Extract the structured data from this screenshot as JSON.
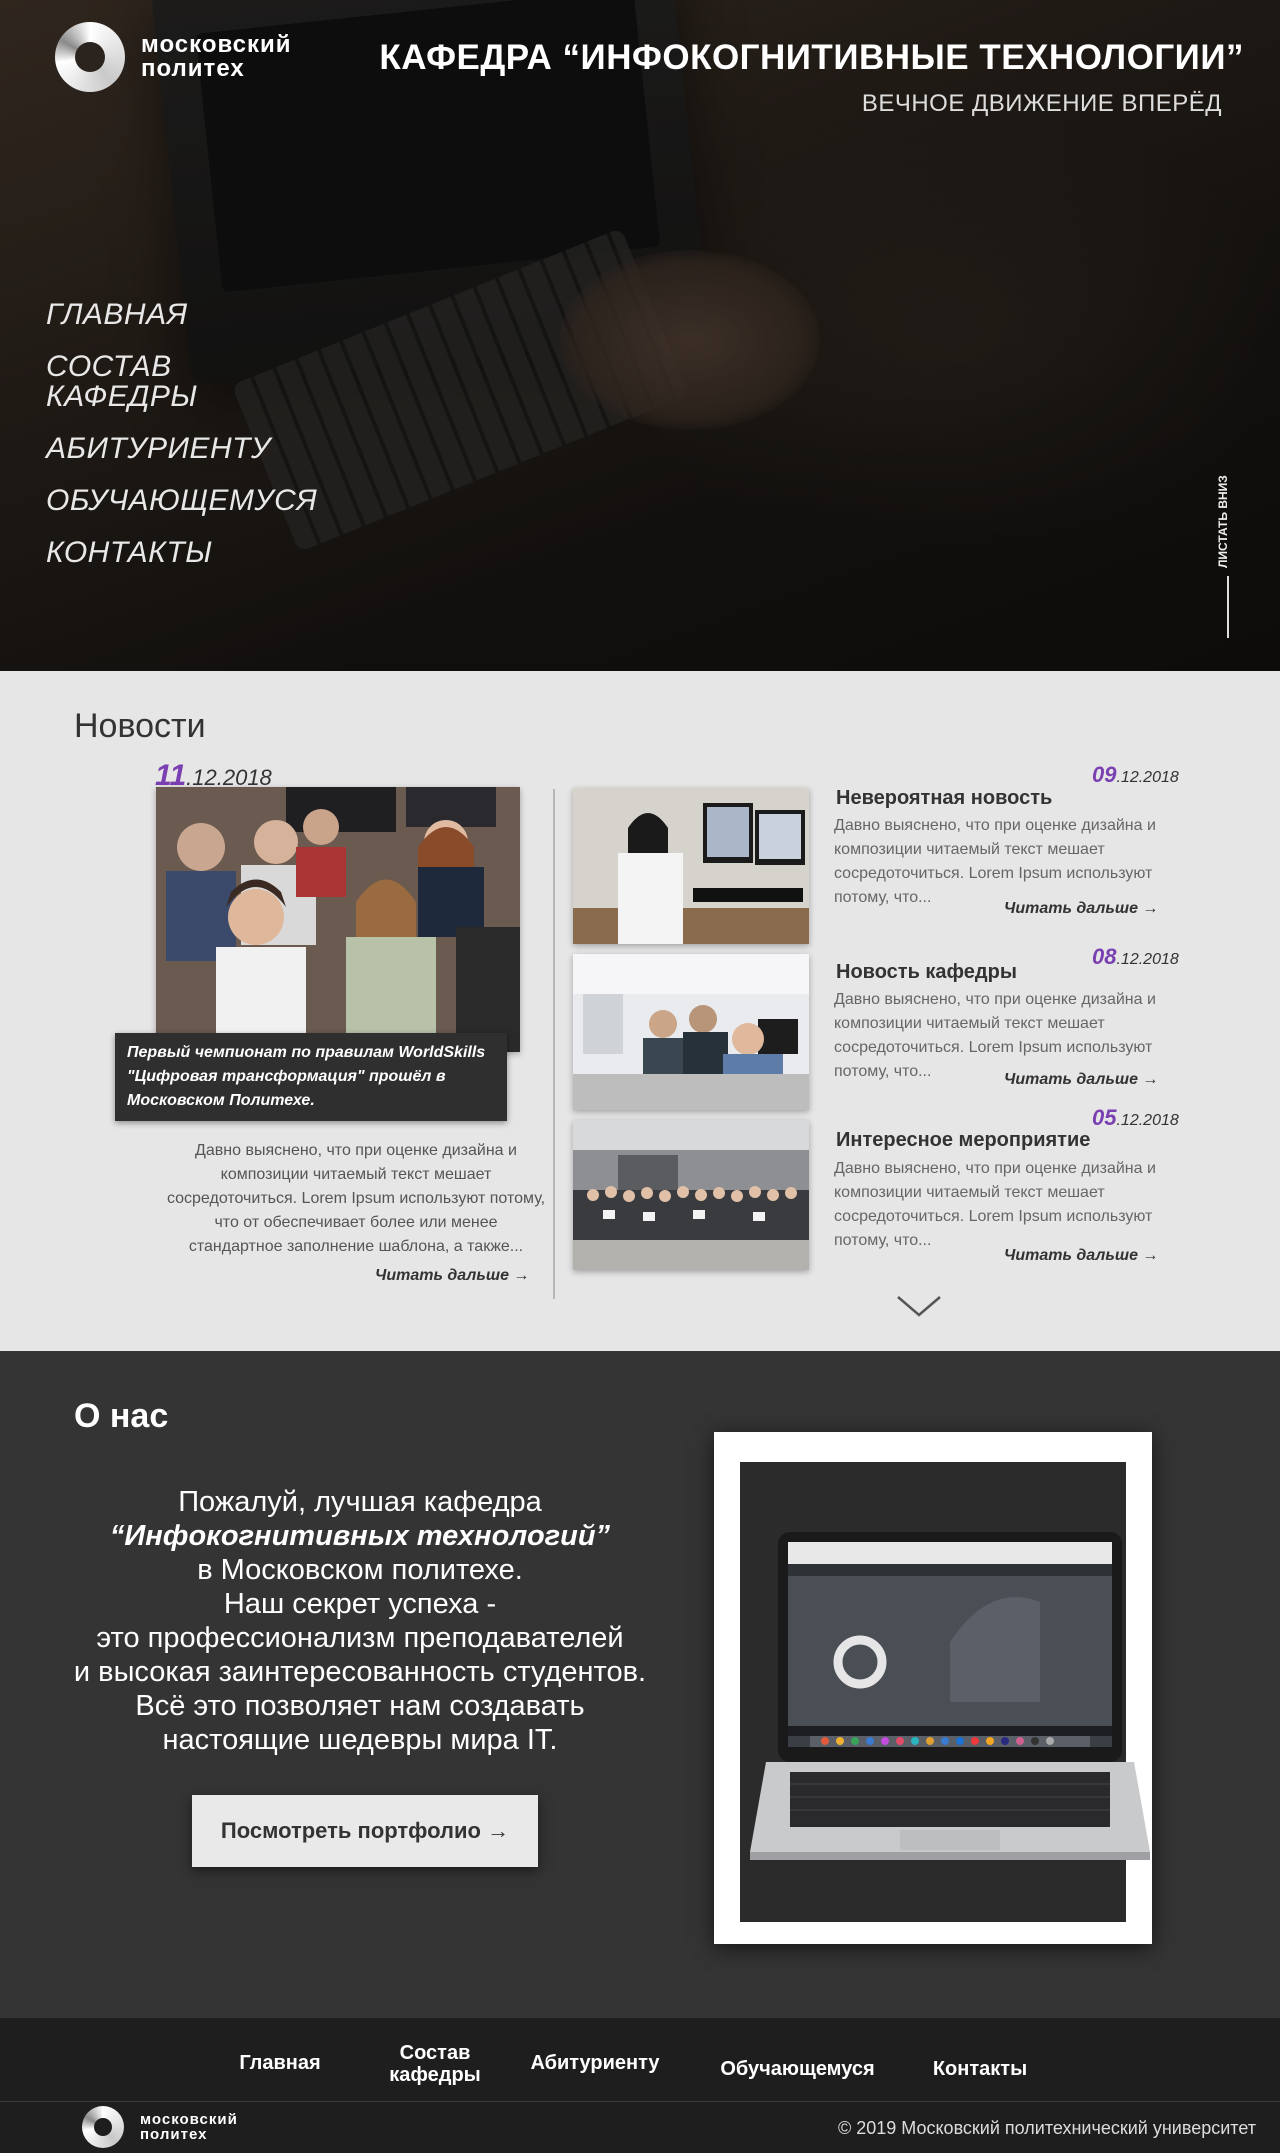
{
  "header": {
    "logo_text": "московский политех",
    "title": "КАФЕДРА “ИНФОКОГНИТИВНЫЕ ТЕХНОЛОГИИ”",
    "subtitle": "ВЕЧНОЕ ДВИЖЕНИЕ ВПЕРЁД"
  },
  "side_nav": {
    "items": [
      {
        "label": "ГЛАВНАЯ"
      },
      {
        "label": "СОСТАВ КАФЕДРЫ"
      },
      {
        "label": "АБИТУРИЕНТУ"
      },
      {
        "label": "ОБУЧАЮЩЕМУСЯ"
      },
      {
        "label": "КОНТАКТЫ"
      }
    ]
  },
  "scroll_hint": "ЛИСТАТЬ ВНИЗ",
  "news": {
    "heading": "Новости",
    "featured": {
      "date_day": "11",
      "date_rest": ".12.2018",
      "caption": "Первый чемпионат по правилам WorldSkills \"Цифровая трансформация\" прошёл в Московском Политехе.",
      "text": "Давно выяснено, что при оценке дизайна и композиции читаемый текст мешает сосредоточиться. Lorem Ipsum используют потому, что от обеспечивает более или менее стандартное заполнение шаблона, а также...",
      "more": "Читать дальше →"
    },
    "items": [
      {
        "title": "Невероятная новость",
        "date_day": "09",
        "date_rest": ".12.2018",
        "text": "Давно выяснено, что при оценке дизайна и композиции читаемый текст мешает сосредоточиться. Lorem Ipsum используют потому, что...",
        "more": "Читать дальше →"
      },
      {
        "title": "Новость кафедры",
        "date_day": "08",
        "date_rest": ".12.2018",
        "text": "Давно выяснено, что при оценке дизайна и композиции читаемый текст мешает сосредоточиться. Lorem Ipsum используют потому, что...",
        "more": "Читать дальше →"
      },
      {
        "title": "Интересное мероприятие",
        "date_day": "05",
        "date_rest": ".12.2018",
        "text": "Давно выяснено, что при оценке дизайна и композиции читаемый текст мешает сосредоточиться. Lorem Ipsum используют потому, что...",
        "more": "Читать дальше →"
      }
    ]
  },
  "about": {
    "heading": "О нас",
    "line1": "Пожалуй, лучшая кафедра",
    "line2": "“Инфокогнитивных технологий”",
    "line3": "в Московском политехе.",
    "line4": "Наш секрет успеха -",
    "line5": "это профессионализм преподавателей",
    "line6": "и высокая заинтересованность студентов.",
    "line7": "Всё это позволяет нам создавать",
    "line8": "настоящие шедевры мира IT.",
    "button": "Посмотреть портфолио →"
  },
  "footer": {
    "nav": [
      {
        "label": "Главная"
      },
      {
        "label": "Состав кафедры"
      },
      {
        "label": "Абитуриенту"
      },
      {
        "label": "Обучающемуся"
      },
      {
        "label": "Контакты"
      }
    ],
    "logo_text": "московский политех",
    "copyright": "© 2019 Московский политехнический университет"
  },
  "colors": {
    "accent": "#7a3fb0",
    "news_bg": "#e6e6e6",
    "about_bg": "#343434",
    "footer_bg": "#1e1e1e"
  },
  "icons": [
    "logo-ring-icon",
    "chevron-down-icon",
    "arrow-right-icon"
  ]
}
